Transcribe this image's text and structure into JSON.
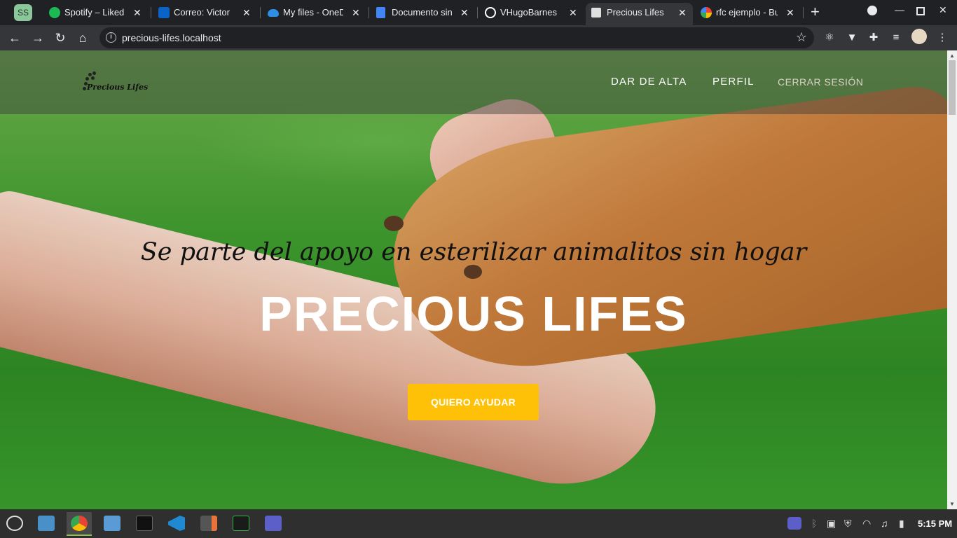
{
  "browser": {
    "profile_badge": "SS",
    "tabs": [
      {
        "title": "Spotify – Liked S",
        "favicon_color": "#1db954"
      },
      {
        "title": "Correo: Victor H",
        "favicon_color": "#0a64c8"
      },
      {
        "title": "My files - OneD",
        "favicon_color": "#2c8ee6"
      },
      {
        "title": "Documento sin",
        "favicon_color": "#4285f4"
      },
      {
        "title": "VHugoBarnes (",
        "favicon_color": "#ffffff"
      },
      {
        "title": "Precious Lifes",
        "favicon_color": "#e0e0e0",
        "active": true
      },
      {
        "title": "rfc ejemplo - Bu",
        "favicon_color": "#ea4335"
      }
    ],
    "url": "precious-lifes.localhost"
  },
  "site": {
    "logo_text": "Precious Lifes",
    "nav": [
      "DAR DE ALTA",
      "PERFIL",
      "CERRAR SESIÓN"
    ],
    "tagline": "Se parte del apoyo en esterilizar animalitos sin hogar",
    "hero_title": "PRECIOUS LIFES",
    "cta_label": "QUIERO AYUDAR",
    "accent_color": "#ffc107"
  },
  "taskbar": {
    "apps": [
      "menu",
      "files",
      "chrome",
      "folder",
      "terminal",
      "vscode",
      "calculator",
      "system-monitor",
      "teams"
    ],
    "clock": "5:15 PM"
  }
}
